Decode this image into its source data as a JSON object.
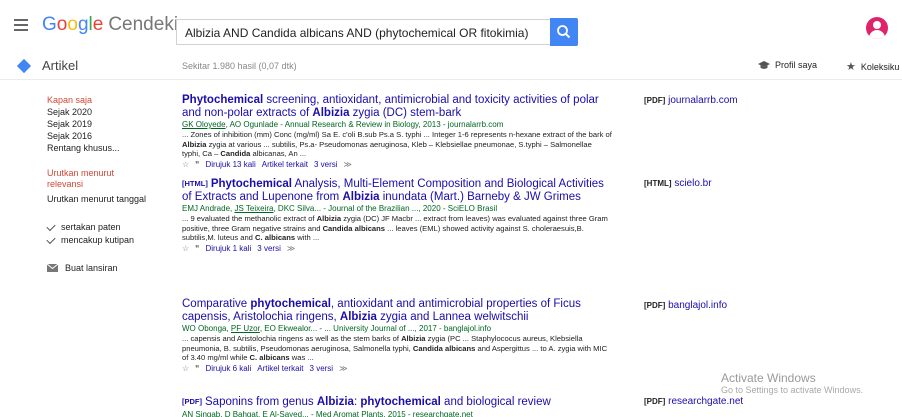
{
  "header": {
    "logo_letters": [
      "G",
      "o",
      "o",
      "g",
      "l",
      "e"
    ],
    "logo_rest": "Cendekia",
    "search_value": "Albizia AND Candida albicans AND (phytochemical OR fitokimia)"
  },
  "subbar": {
    "articles_label": "Artikel",
    "result_count": "Sekitar 1.980 hasil (0,07 dtk)",
    "profile_label": "Profil saya",
    "library_label": "Koleksiku"
  },
  "sidebar": {
    "time_items": [
      "Kapan saja",
      "Sejak 2020",
      "Sejak 2019",
      "Sejak 2016",
      "Rentang khusus..."
    ],
    "sort_relevance": "Urutkan menurut relevansi",
    "sort_date": "Urutkan menurut tanggal",
    "include_patents": "sertakan paten",
    "include_citations": "mencakup kutipan",
    "create_alert": "Buat lansiran"
  },
  "results": [
    {
      "tag": "",
      "title_html": "<b>Phytochemical</b> screening, antioxidant, antimicrobial and toxicity activities of polar and non-polar extracts of <b>Albizia</b> zygia (DC) stem-bark",
      "authors_html": "<u>GK Oloyede</u>, AO Ogunlade - Annual Research &amp; Review in Biology, 2013 - journalarrb.com",
      "snippet_html": "... Zones of inhibition (mm) Conc (mg/ml) Sa E. c'oli B.sub Ps.a S. typhi ... Integer 1-6 represents n-hexane extract of the bark of <b>Albizia</b> zygia at various ... subtilis, Ps.a- Pseudomonas aeruginosa, Kleb – Klebsiellae pneumonae, S.typhi – Salmonellae typhi, Ca – <b>Candida</b> albicanas, An ...",
      "cited": "Dirujuk 13 kali",
      "related": "Artikel terkait",
      "versions": "3 versi",
      "side_type": "[PDF]",
      "side_site": "journalarrb.com"
    },
    {
      "tag": "[HTML]",
      "title_html": "<b>Phytochemical</b> Analysis, Multi-Element Composition and Biological Activities of Extracts and Lupenone from <b>Albizia</b> inundata (Mart.) Barneby &amp; JW Grimes",
      "authors_html": "EMJ Andrade, <u>JS Teixeira</u>, DKC Silva... - Journal of the Brazilian ..., 2020 - SciELO Brasil",
      "snippet_html": "... 9 evaluated the methanolic extract of <b>Albizia</b> zygia (DC) JF Macbr ... extract from leaves) was evaluated against three Gram positive, three Gram negative strains and <b>Candida albicans</b> ... leaves (EML) showed activity against S. choleraesuis,B. subtilis,M. luteus and <b>C. albicans</b> with ...",
      "cited": "Dirujuk 1 kali",
      "related": "",
      "versions": "3 versi",
      "side_type": "[HTML]",
      "side_site": "scielo.br"
    },
    {
      "tag": "",
      "title_html": "Comparative <b>phytochemical</b>, antioxidant and antimicrobial properties of Ficus capensis, Aristolochia ringens, <b>Albizia</b> zygia and Lannea welwitschii",
      "authors_html": "WO Obonga, <u>PF Uzor</u>, EO Ekwealor... - ... University Journal of ..., 2017 - banglajol.info",
      "snippet_html": "... capensis and Aristolochia ringens as well as the stem barks of <b>Albizia</b> zygia (PC ... Staphylococus aureus, Klebsiella pneumonia, B. subtilis, Pseudomonas aeruginosa, Salmonella typhi, <b>Candida albicans</b> and Aspergittus ... to A. zygia with MIC of 3.40 mg/ml while <b>C. albicans</b> was ...",
      "cited": "Dirujuk 6 kali",
      "related": "Artikel terkait",
      "versions": "3 versi",
      "side_type": "[PDF]",
      "side_site": "banglajol.info"
    },
    {
      "tag": "[PDF]",
      "title_html": "Saponins from genus <b>Albizia</b>: <b>phytochemical</b> and biological review",
      "authors_html": "AN Singab, D Bahgat, E Al-Sayed... - Med Aromat Plants, 2015 - researchgate.net",
      "snippet_html": "",
      "cited": "",
      "related": "",
      "versions": "",
      "side_type": "[PDF]",
      "side_site": "researchgate.net"
    }
  ],
  "watermark": {
    "line1": "Activate Windows",
    "line2": "Go to Settings to activate Windows."
  }
}
